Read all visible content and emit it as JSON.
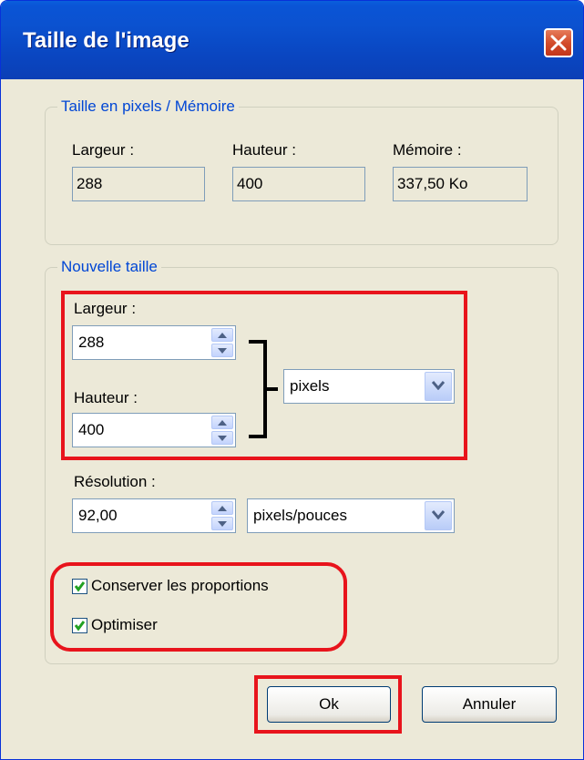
{
  "window": {
    "title": "Taille de l'image"
  },
  "memory_group": {
    "legend": "Taille en pixels / Mémoire",
    "width_label": "Largeur :",
    "width_value": "288",
    "height_label": "Hauteur :",
    "height_value": "400",
    "memory_label": "Mémoire :",
    "memory_value": "337,50 Ko"
  },
  "new_size_group": {
    "legend": "Nouvelle taille",
    "width_label": "Largeur :",
    "width_value": "288",
    "height_label": "Hauteur :",
    "height_value": "400",
    "unit_selected": "pixels",
    "resolution_label": "Résolution :",
    "resolution_value": "92,00",
    "resolution_unit_selected": "pixels/pouces",
    "keep_proportions_label": "Conserver les proportions",
    "keep_proportions_checked": true,
    "optimize_label": "Optimiser",
    "optimize_checked": true
  },
  "buttons": {
    "ok": "Ok",
    "cancel": "Annuler"
  },
  "colors": {
    "titlebar": "#0a54d6",
    "legend_text": "#0046d5",
    "highlight": "#e8141c",
    "dialog_bg": "#ece9d8",
    "check": "#21a121"
  }
}
